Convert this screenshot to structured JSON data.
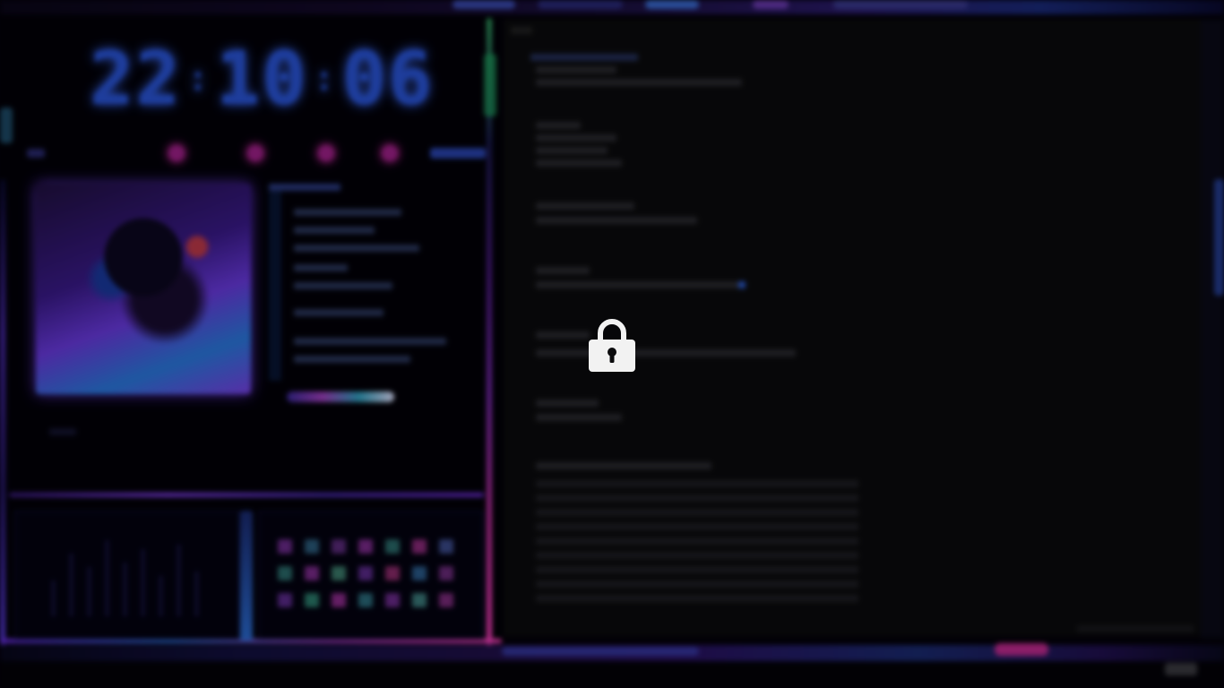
{
  "screen": {
    "state": "locked",
    "overlay_icon": "padlock-icon"
  },
  "clock": {
    "hours": "22",
    "minutes": "10",
    "seconds": "06",
    "separator": ":"
  },
  "theme": {
    "accent_blue": "#2a55d8",
    "accent_magenta": "#ff30c0",
    "accent_purple": "#6a3ae0",
    "terminal_bg": "#0b0b0d",
    "lock_icon_color": "#f2f2f2"
  },
  "media_player": {
    "album_art_icon": "album-art-image"
  },
  "terminal": {
    "content_legible": false
  }
}
